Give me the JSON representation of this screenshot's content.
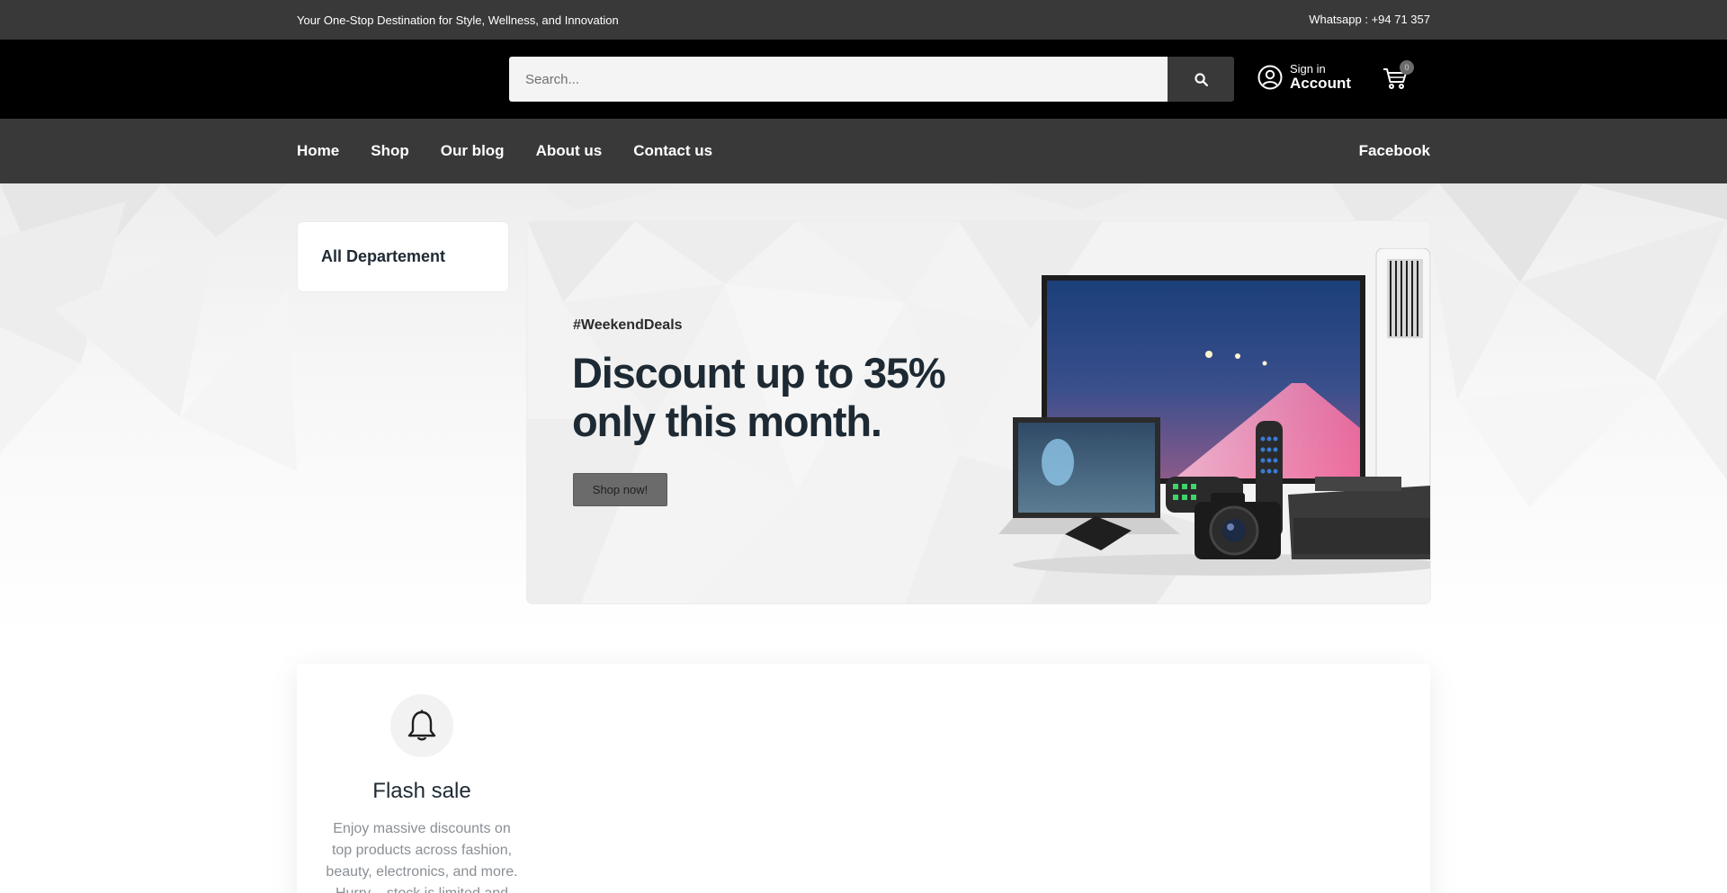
{
  "topbar": {
    "tagline": "Your One-Stop Destination for Style, Wellness, and Innovation",
    "whatsapp": "Whatsapp : +94 71 357"
  },
  "header": {
    "search_placeholder": "Search...",
    "account_small": "Sign in",
    "account_big": "Account",
    "cart_count": "0"
  },
  "nav": {
    "items": [
      "Home",
      "Shop",
      "Our blog",
      "About us",
      "Contact us"
    ],
    "social": "Facebook"
  },
  "sidebar": {
    "departments_label": "All Departement"
  },
  "hero": {
    "tag": "#WeekendDeals",
    "headline": "Discount up to 35% only this month.",
    "button": "Shop now!"
  },
  "feature": {
    "icon": "bell-icon",
    "title": "Flash sale",
    "description": "Enjoy massive discounts on top products across fashion, beauty, electronics, and more. Hurry – stock is limited and"
  },
  "colors": {
    "topbar": "#393939",
    "header": "#000000",
    "nav": "#393939",
    "button": "#6b6b6b",
    "headline": "#1e2a33"
  }
}
